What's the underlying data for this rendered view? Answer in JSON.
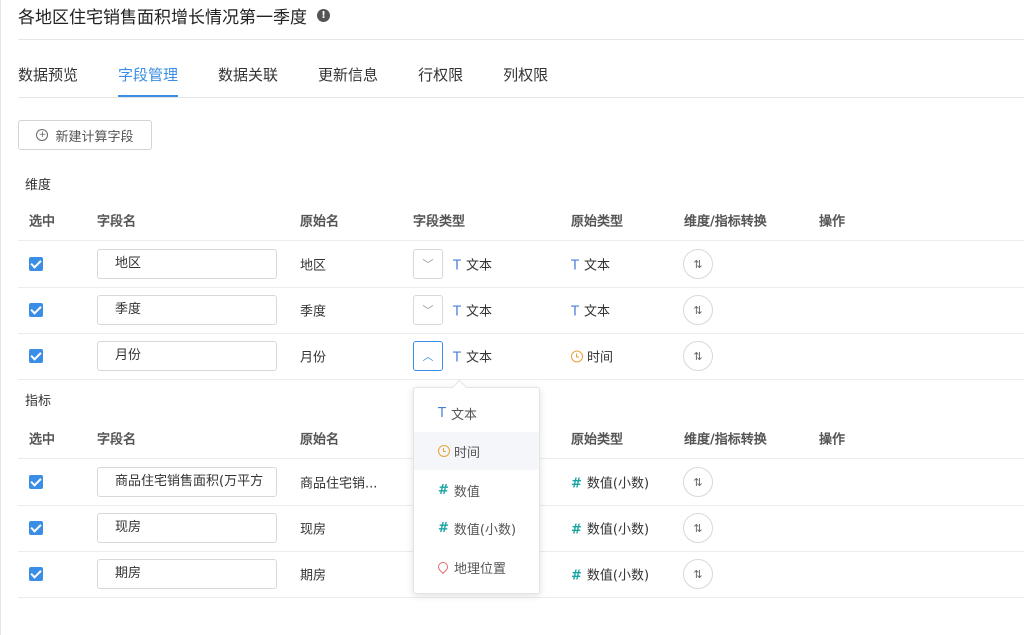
{
  "title": "各地区住宅销售面积增长情况第一季度",
  "tabs": [
    "数据预览",
    "字段管理",
    "数据关联",
    "更新信息",
    "行权限",
    "列权限"
  ],
  "active_tab": "字段管理",
  "new_field_button": "新建计算字段",
  "columns": {
    "select": "选中",
    "field_name": "字段名",
    "original_name": "原始名",
    "field_type": "字段类型",
    "original_type": "原始类型",
    "convert": "维度/指标转换",
    "action": "操作"
  },
  "dimensions": {
    "label": "维度",
    "rows": [
      {
        "field_name": "地区",
        "original_name": "地区",
        "field_type": "文本",
        "original_type": "文本",
        "original_type_icon": "text-icon",
        "checked": true
      },
      {
        "field_name": "季度",
        "original_name": "季度",
        "field_type": "文本",
        "original_type": "文本",
        "original_type_icon": "text-icon",
        "checked": true
      },
      {
        "field_name": "月份",
        "original_name": "月份",
        "field_type": "文本",
        "original_type": "时间",
        "original_type_icon": "clock-icon",
        "checked": true
      }
    ]
  },
  "metrics": {
    "label": "指标",
    "rows": [
      {
        "field_name": "商品住宅销售面积(万平方",
        "original_name": "商品住宅销...",
        "original_type": "数值(小数)",
        "checked": true
      },
      {
        "field_name": "现房",
        "original_name": "现房",
        "original_type": "数值(小数)",
        "checked": true
      },
      {
        "field_name": "期房",
        "original_name": "期房",
        "original_type": "数值(小数)",
        "checked": true
      }
    ]
  },
  "type_dropdown": {
    "options": [
      {
        "label": "文本",
        "icon": "text-icon"
      },
      {
        "label": "时间",
        "icon": "clock-icon"
      },
      {
        "label": "数值",
        "icon": "hash-icon"
      },
      {
        "label": "数值(小数)",
        "icon": "hash-icon"
      },
      {
        "label": "地理位置",
        "icon": "location-pin-icon"
      }
    ],
    "hovered": "时间"
  },
  "colors": {
    "accent": "#3a8ee6",
    "text_icon": "#4a7dd8",
    "number_icon": "#1aa5a5",
    "time_icon": "#e8a33a",
    "geo_icon": "#e06a6a"
  }
}
